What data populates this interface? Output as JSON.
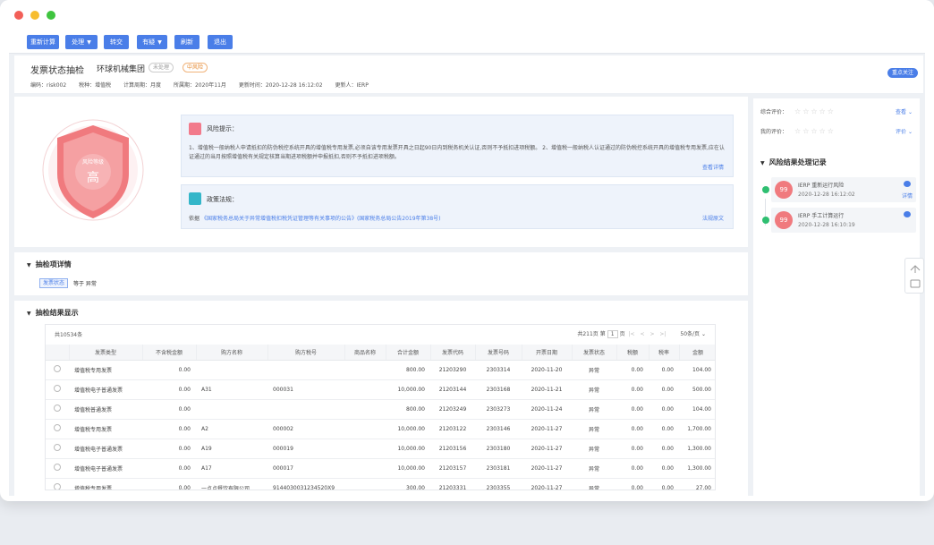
{
  "toolbar": {
    "buttons": [
      {
        "label": "重新计算"
      },
      {
        "label": "处理"
      },
      {
        "label": "转交"
      },
      {
        "label": "有疑"
      },
      {
        "label": "刷新"
      },
      {
        "label": "退出"
      }
    ]
  },
  "header": {
    "title": "发票状态抽检",
    "company": "环球机械集团",
    "tag_status": "未处理",
    "tag_level": "中风险",
    "meta": {
      "code": "编码：risk002",
      "tax": "税种：增值税",
      "period_type": "计算周期：月度",
      "period": "所属期：2020年11月",
      "updated": "更新时间：2020-12-28 16:12:02",
      "updater": "更新人：IERP"
    },
    "focus_label": "重点关注"
  },
  "risk": {
    "shield_caption": "风险等级",
    "shield_level": "高",
    "tip_label": "风险提示：",
    "tip_text": "1、增值税一般纳税人申请抵扣的防伪税控系统开具的增值税专用发票,必须自该专用发票开具之日起90日内到税务机关认证,否则不予抵扣进项税额。 2、增值税一般纳税人认证通过的防伪税控系统开具的增值税专用发票,应在认证通过的当月按照增值税有关规定核算当期进项税额并申报抵扣,否则不予抵扣进项税额。",
    "tip_more": "查看详情",
    "law_label": "政策法规：",
    "law_prefix": "依据",
    "law_link": "《国家税务总局关于异常增值税扣税凭证管理等有关事项的公告》(国家税务总局公告2019年第38号)",
    "law_more": "法规原文"
  },
  "detail": {
    "title": "抽检项详情",
    "cond_tag": "发票状态",
    "cond_text": "等于  异常"
  },
  "results": {
    "title": "抽检结果显示",
    "count": "共10534条",
    "pager": {
      "pages_text": "共211页",
      "page_prefix": "第",
      "page": "1",
      "page_suffix": "页",
      "first": "|<",
      "prev": "<",
      "next": ">",
      "last": ">|",
      "page_size": "50条/页"
    },
    "columns": [
      "",
      "发票类型",
      "不含税金额",
      "购方名称",
      "购方税号",
      "商品名称",
      "合计金额",
      "发票代码",
      "发票号码",
      "开票日期",
      "发票状态",
      "税额",
      "税率",
      "金额"
    ],
    "rows": [
      [
        "",
        "增值税专用发票",
        "0.00",
        "",
        "",
        "",
        "800.00",
        "21203290",
        "2303314",
        "2020-11-20",
        "异常",
        "0.00",
        "0.00",
        "104.00"
      ],
      [
        "",
        "增值税电子普通发票",
        "0.00",
        "A31",
        "000031",
        "",
        "10,000.00",
        "21203144",
        "2303168",
        "2020-11-21",
        "异常",
        "0.00",
        "0.00",
        "500.00"
      ],
      [
        "",
        "增值税普通发票",
        "0.00",
        "",
        "",
        "",
        "800.00",
        "21203249",
        "2303273",
        "2020-11-24",
        "异常",
        "0.00",
        "0.00",
        "104.00"
      ],
      [
        "",
        "增值税专用发票",
        "0.00",
        "A2",
        "000002",
        "",
        "10,000.00",
        "21203122",
        "2303146",
        "2020-11-27",
        "异常",
        "0.00",
        "0.00",
        "1,700.00"
      ],
      [
        "",
        "增值税电子普通发票",
        "0.00",
        "A19",
        "000019",
        "",
        "10,000.00",
        "21203156",
        "2303180",
        "2020-11-27",
        "异常",
        "0.00",
        "0.00",
        "1,300.00"
      ],
      [
        "",
        "增值税电子普通发票",
        "0.00",
        "A17",
        "000017",
        "",
        "10,000.00",
        "21203157",
        "2303181",
        "2020-11-27",
        "异常",
        "0.00",
        "0.00",
        "1,300.00"
      ],
      [
        "",
        "增值税专用发票",
        "0.00",
        "一点点餐饮有限公司",
        "91440300312345​20X9",
        "",
        "300.00",
        "21203331",
        "2303355",
        "2020-11-27",
        "异常",
        "0.00",
        "0.00",
        "27.00"
      ]
    ]
  },
  "side": {
    "overall_label": "综合评价：",
    "overall_link": "查看",
    "my_label": "我的评价：",
    "my_link": "评价",
    "stars": "☆☆☆☆☆",
    "records_title": "风险结果处理记录",
    "records": [
      {
        "avatar": "99",
        "who": "IERP  重新运行风险",
        "time": "2020-12-28 16:12:02",
        "detail": "详情"
      },
      {
        "avatar": "99",
        "who": "IERP  手工计算运行",
        "time": "2020-12-28 16:10:19",
        "detail": ""
      }
    ]
  },
  "colors": {
    "accent": "#4a7ee8",
    "shield": "#f07a7e",
    "success": "#2fbf71"
  }
}
